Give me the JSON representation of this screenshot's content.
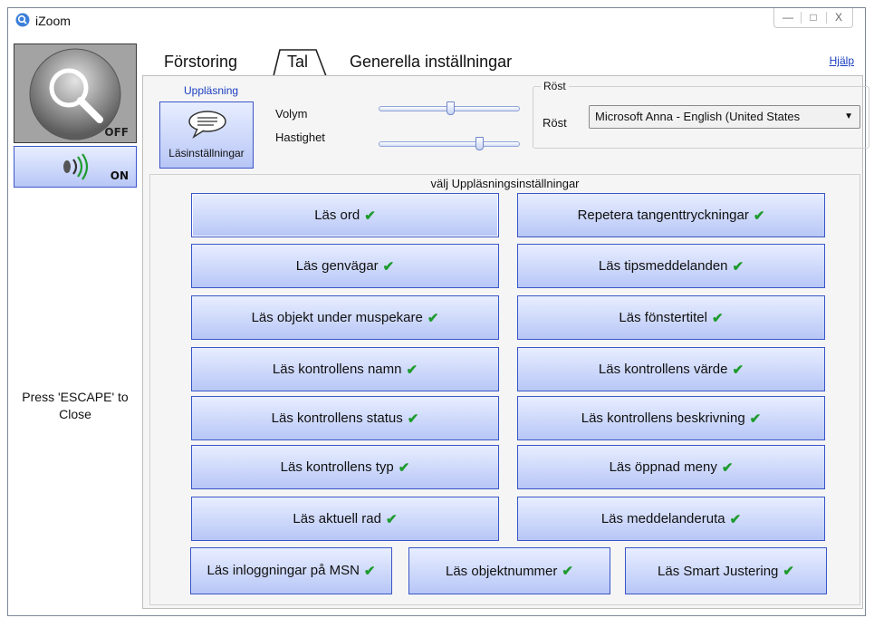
{
  "window": {
    "title": "iZoom",
    "controls": [
      "—",
      "□",
      "X"
    ]
  },
  "left": {
    "zoom_state": "OFF",
    "speech_state": "ON",
    "escape_text": "Press 'ESCAPE' to Close"
  },
  "tabs": [
    {
      "label": "Förstoring",
      "active": false
    },
    {
      "label": "Tal",
      "active": true
    },
    {
      "label": "Generella inställningar",
      "active": false
    }
  ],
  "help": "Hjälp",
  "speech_panel": {
    "section_label": "Uppläsning",
    "read_settings_button": "Läsinställningar",
    "volume_label": "Volym",
    "volume_value": 0.5,
    "speed_label": "Hastighet",
    "speed_value": 0.72,
    "voice_group_title": "Röst",
    "voice_label": "Röst",
    "voice_selected": "Microsoft Anna - English (United States"
  },
  "options": {
    "title": "välj Uppläsningsinställningar",
    "check_glyph": "✔",
    "items": [
      {
        "label": "Läs ord",
        "checked": true
      },
      {
        "label": "Repetera tangenttryckningar",
        "checked": true
      },
      {
        "label": "Läs genvägar",
        "checked": true
      },
      {
        "label": "Läs tipsmeddelanden",
        "checked": true
      },
      {
        "label": "Läs objekt under muspekare",
        "checked": true
      },
      {
        "label": "Läs fönstertitel",
        "checked": true
      },
      {
        "label": "Läs kontrollens namn",
        "checked": true
      },
      {
        "label": "Läs kontrollens värde",
        "checked": true
      },
      {
        "label": "Läs kontrollens status",
        "checked": true
      },
      {
        "label": "Läs kontrollens beskrivning",
        "checked": true
      },
      {
        "label": "Läs kontrollens typ",
        "checked": true
      },
      {
        "label": "Läs öppnad meny",
        "checked": true
      },
      {
        "label": "Läs aktuell rad",
        "checked": true
      },
      {
        "label": "Läs meddelanderuta",
        "checked": true
      },
      {
        "label": "Läs inloggningar på MSN",
        "checked": true
      },
      {
        "label": "Läs objektnummer",
        "checked": true
      },
      {
        "label": "Läs Smart Justering",
        "checked": true
      }
    ]
  },
  "colors": {
    "accent": "#3a56c7",
    "check": "#1f9b2f",
    "link": "#1a3fbf"
  }
}
